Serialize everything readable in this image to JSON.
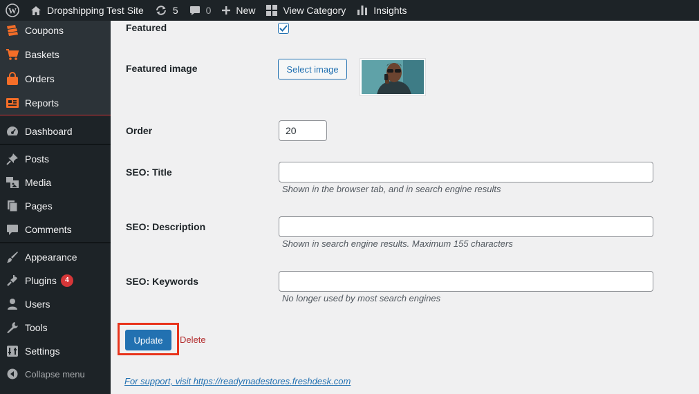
{
  "adminbar": {
    "site_name": "Dropshipping Test Site",
    "updates_count": "5",
    "comments_count": "0",
    "new_label": "New",
    "view_label": "View Category",
    "insights_label": "Insights"
  },
  "sidebar": {
    "submenu": [
      {
        "label": "Coupons",
        "icon": "coupon-icon"
      },
      {
        "label": "Baskets",
        "icon": "basket-icon"
      },
      {
        "label": "Orders",
        "icon": "bag-icon"
      },
      {
        "label": "Reports",
        "icon": "report-icon"
      }
    ],
    "items": [
      {
        "label": "Dashboard",
        "icon": "dashboard-icon"
      },
      {
        "label": "Posts",
        "icon": "pin-icon"
      },
      {
        "label": "Media",
        "icon": "media-icon"
      },
      {
        "label": "Pages",
        "icon": "pages-icon"
      },
      {
        "label": "Comments",
        "icon": "comment-icon"
      },
      {
        "label": "Appearance",
        "icon": "brush-icon"
      },
      {
        "label": "Plugins",
        "icon": "plugin-icon",
        "badge": "4"
      },
      {
        "label": "Users",
        "icon": "user-icon"
      },
      {
        "label": "Tools",
        "icon": "wrench-icon"
      },
      {
        "label": "Settings",
        "icon": "settings-icon"
      }
    ],
    "collapse_label": "Collapse menu"
  },
  "form": {
    "featured_label": "Featured",
    "featured_checked": true,
    "featured_image_label": "Featured image",
    "select_image_label": "Select image",
    "order_label": "Order",
    "order_value": "20",
    "seo_title_label": "SEO: Title",
    "seo_title_value": "",
    "seo_title_help": "Shown in the browser tab, and in search engine results",
    "seo_description_label": "SEO: Description",
    "seo_description_value": "",
    "seo_description_help": "Shown in search engine results. Maximum 155 characters",
    "seo_keywords_label": "SEO: Keywords",
    "seo_keywords_value": "",
    "seo_keywords_help": "No longer used by most search engines",
    "update_label": "Update",
    "delete_label": "Delete",
    "support_text": "For support, visit https://readymadestores.freshdesk.com"
  },
  "colors": {
    "admin_bg": "#1d2327",
    "accent": "#2271b1",
    "highlight": "#e8341c",
    "delete": "#b32d2e",
    "submenu_icon": "#f56e28"
  }
}
